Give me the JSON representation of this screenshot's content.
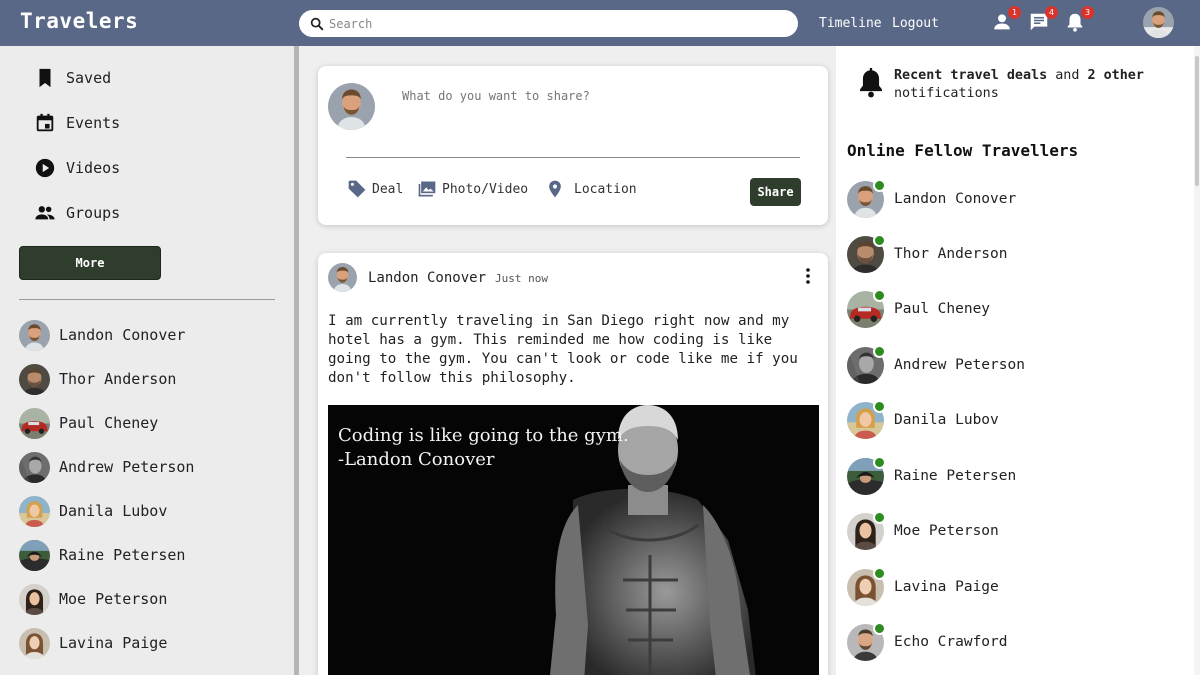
{
  "header": {
    "logo": "Travelers",
    "search_placeholder": "Search",
    "timeline_label": "Timeline",
    "logout_label": "Logout",
    "friend_requests_count": "1",
    "messages_count": "4",
    "notifications_count": "3"
  },
  "left_nav": {
    "items": [
      {
        "label": "Saved",
        "icon": "bookmark-icon"
      },
      {
        "label": "Events",
        "icon": "calendar-icon"
      },
      {
        "label": "Videos",
        "icon": "play-circle-icon"
      },
      {
        "label": "Groups",
        "icon": "group-icon"
      }
    ],
    "more_label": "More"
  },
  "friends": [
    "Landon Conover",
    "Thor Anderson",
    "Paul Cheney",
    "Andrew Peterson",
    "Danila Lubov",
    "Raine Petersen",
    "Moe Peterson",
    "Lavina Paige"
  ],
  "composer": {
    "placeholder": "What do you want to share?",
    "options": [
      {
        "label": "Deal",
        "icon": "tag-icon"
      },
      {
        "label": "Photo/Video",
        "icon": "photo-icon"
      },
      {
        "label": "Location",
        "icon": "location-pin-icon"
      }
    ],
    "share_label": "Share"
  },
  "post": {
    "author": "Landon Conover",
    "time": "Just now",
    "text": "I am currently traveling in San Diego right now and my hotel has a gym. This reminded me how coding is like going to the gym. You can't look or code like me if you don't follow this philosophy.",
    "image_quote_line1": "Coding is like going to the gym.",
    "image_quote_line2": "-Landon Conover"
  },
  "notification": {
    "bold1": "Recent travel deals",
    "and": "and",
    "bold2": "2 other",
    "rest": "notifications"
  },
  "online": {
    "title": "Online Fellow Travellers",
    "people": [
      "Landon Conover",
      "Thor Anderson",
      "Paul Cheney",
      "Andrew Peterson",
      "Danila Lubov",
      "Raine Petersen",
      "Moe Peterson",
      "Lavina Paige",
      "Echo Crawford"
    ]
  },
  "colors": {
    "header_bg": "#5a6887",
    "button_bg": "#2f3e2c",
    "badge": "#d9342b",
    "online_dot": "#2e8b1f"
  }
}
